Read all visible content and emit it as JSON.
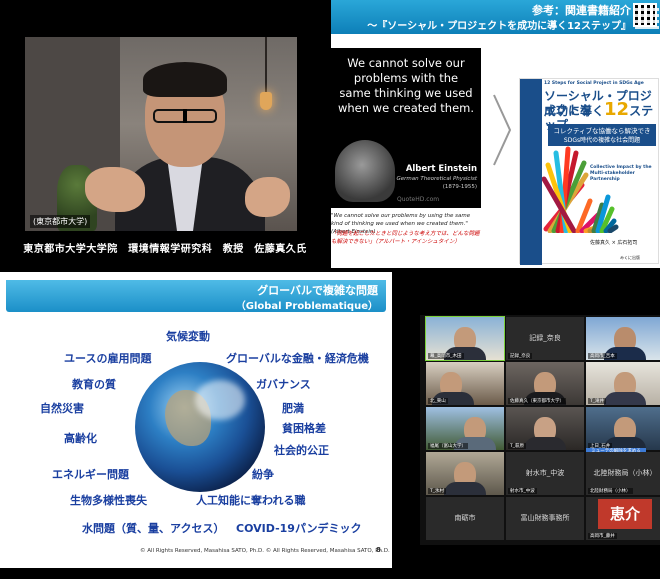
{
  "video": {
    "tag": "(東京都市大学)",
    "caption": "東京都市大学大学院　環境情報学研究科　教授　佐藤真久氏"
  },
  "book_slide": {
    "heading_line1": "参考：関連書籍紹介",
    "heading_line2": "～『ソーシャル・プロジェクトを成功に導く12ステップ』",
    "quote_main": "We cannot solve our problems with the same thinking we used when we created them.",
    "quote_author": "Albert Einstein",
    "quote_author_title": "German Theoretical Physicist",
    "quote_author_years": "(1879-1955)",
    "quote_watermark": "QuoteHD.com",
    "quote_en_small": "\"We cannot solve our problems by using the same kind of thinking we used when we created them.\" (Albert Einstein)",
    "quote_ja_small": "「問題を起こしたときと同じような考え方では、どんな問題も解決できない」（アルバート・アインシュタイン）",
    "book_top_label": "12 Steps for Social Project in SDGs Age",
    "book_title_line1": "ソーシャル・プロジェクトを",
    "book_title_line2_pre": "成功に導く",
    "book_title_num": "12",
    "book_title_line2_post": "ステップ",
    "book_sub1": "コレクティブな協働なら解決できる！",
    "book_sub2": "SDGs時代の複雑な社会問題",
    "book_collab": "Collective Impact by the Multi-stakeholder Partnership",
    "book_authors": "佐藤真久 × 広石拓司",
    "book_publisher": "みくに出版",
    "colors": {
      "header": "#1b8fc8",
      "book_blue": "#1a4e8a",
      "accent_yellow": "#e8a800"
    }
  },
  "gp_slide": {
    "title": "グローバルで複雑な問題",
    "subtitle": "（Global Problematique）",
    "terms": [
      {
        "id": "climate",
        "text": "気候変動"
      },
      {
        "id": "youth",
        "text": "ユースの雇用問題"
      },
      {
        "id": "finance",
        "text": "グローバルな金融・経済危機"
      },
      {
        "id": "education",
        "text": "教育の質"
      },
      {
        "id": "governance",
        "text": "ガバナンス"
      },
      {
        "id": "disaster",
        "text": "自然災害"
      },
      {
        "id": "obesity",
        "text": "肥満"
      },
      {
        "id": "poverty",
        "text": "貧困格差"
      },
      {
        "id": "aging",
        "text": "高齢化"
      },
      {
        "id": "justice",
        "text": "社会的公正"
      },
      {
        "id": "energy",
        "text": "エネルギー問題"
      },
      {
        "id": "conflict",
        "text": "紛争"
      },
      {
        "id": "bio",
        "text": "生物多様性喪失"
      },
      {
        "id": "ai",
        "text": "人工知能に奪われる職"
      },
      {
        "id": "water",
        "text": "水問題（質、量、アクセス）"
      },
      {
        "id": "covid",
        "text": "COVID-19パンデミック"
      }
    ],
    "footer": "© All Rights Reserved, Masahisa SATO, Ph.D. © All Rights Reserved, Masahisa SATO, Ph.D.",
    "page": "8"
  },
  "gallery": {
    "tiles": [
      {
        "name": "幕_高岡市_木田",
        "center": ""
      },
      {
        "name": "記録_奈良",
        "center": "記録_奈良"
      },
      {
        "name": "高岡市_吉本",
        "center": ""
      },
      {
        "name": "北_東山",
        "center": ""
      },
      {
        "name": "佐藤真久（東京都市大学）",
        "center": ""
      },
      {
        "name": "T_滝井",
        "center": ""
      },
      {
        "name": "福尾（富山大学）",
        "center": ""
      },
      {
        "name": "T_萩原",
        "center": ""
      },
      {
        "name": "上日_石井",
        "center": ""
      },
      {
        "name": "T_氷村",
        "center": ""
      },
      {
        "name": "射水市_中波",
        "center": "射水市_中波"
      },
      {
        "name": "北陸財務局（小林）",
        "center": "北陸財務局（小林）"
      },
      {
        "name": "南砺市",
        "center": "南砺市"
      },
      {
        "name": "富山財務事務所",
        "center": "富山財務事務所"
      },
      {
        "name": "高岡市_藤井",
        "center": "恵介"
      }
    ],
    "sub_banner": "ミューテの解除を求める"
  }
}
